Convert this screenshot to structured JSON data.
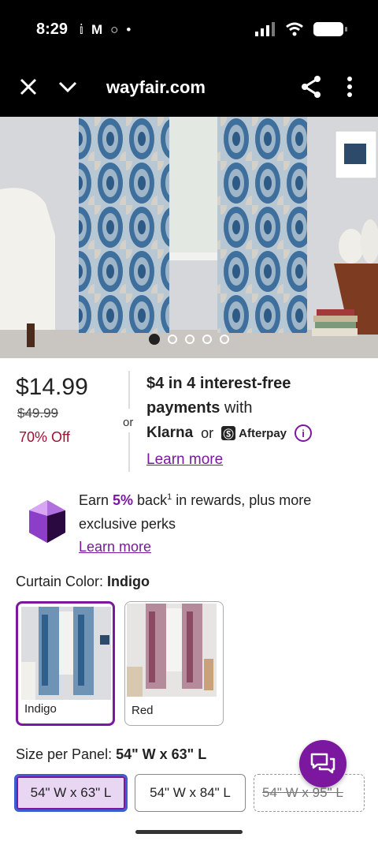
{
  "status_bar": {
    "time": "8:29"
  },
  "browser": {
    "title": "wayfair.com"
  },
  "gallery": {
    "dot_count": 5,
    "active_index": 0
  },
  "pricing": {
    "price": "$14.99",
    "original_price": "$49.99",
    "discount": "70% Off",
    "or_label": "or",
    "installment_amount": "$4",
    "installment_text": " in 4 interest-free",
    "payments_word": "payments",
    "with_text": " with",
    "klarna": "Klarna",
    "or_between": "or",
    "afterpay": "Afterpay",
    "learn_more": "Learn more"
  },
  "rewards": {
    "earn_prefix": "Earn ",
    "earn_pct": "5%",
    "earn_suffix": " back",
    "superscript": "1",
    "earn_tail": " in rewards, plus more",
    "line2": "exclusive perks",
    "learn_more": "Learn more"
  },
  "color": {
    "label": "Curtain Color: ",
    "selected": "Indigo",
    "options": [
      {
        "label": "Indigo",
        "selected": true
      },
      {
        "label": "Red",
        "selected": false
      }
    ]
  },
  "size": {
    "label": "Size per Panel: ",
    "selected": "54\" W x 63\" L",
    "options": [
      {
        "label": "54\" W x 63\" L",
        "selected": true
      },
      {
        "label": "54\" W x 84\" L",
        "selected": false
      },
      {
        "label": "54\" W x 95\" L",
        "selected": false,
        "unavailable": true
      }
    ]
  },
  "colors": {
    "accent": "#7b189f",
    "sale": "#a01030"
  }
}
